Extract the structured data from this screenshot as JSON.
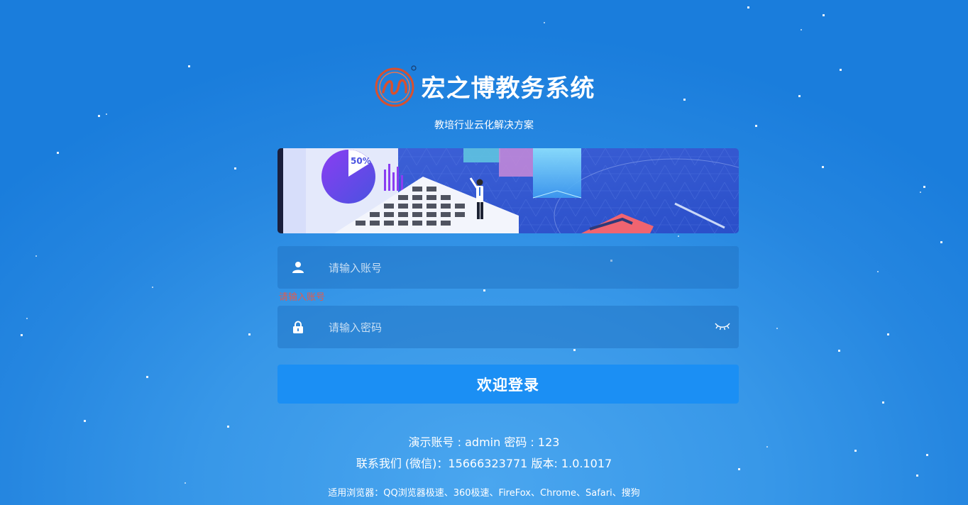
{
  "brand": {
    "title": "宏之博教务系统",
    "subtitle": "教培行业云化解决方案"
  },
  "banner": {
    "chart_label": "50%"
  },
  "login_form": {
    "account_placeholder": "请输入账号",
    "account_error": "请输入账号",
    "password_placeholder": "请输入密码",
    "submit_label": "欢迎登录"
  },
  "footer": {
    "demo_account": "演示账号 : admin 密码 : 123",
    "contact": "联系我们 (微信)：15666323771 版本: 1.0.1017",
    "browsers": "适用浏览器：QQ浏览器极速、360极速、FireFox、Chrome、Safari、搜狗"
  },
  "icons": {
    "account": "user-icon",
    "password": "lock-icon",
    "toggle_password": "eye-closed-icon"
  },
  "colors": {
    "accent": "#1b8ff4",
    "error": "#e55a4b",
    "background": "#2586e0"
  }
}
